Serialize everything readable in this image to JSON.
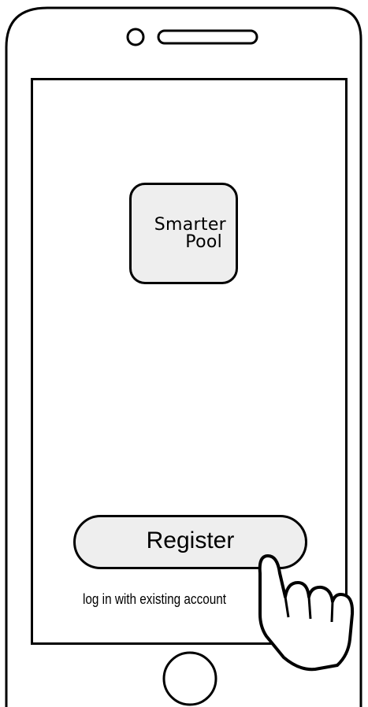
{
  "app": {
    "logo_line1": "Smarter",
    "logo_line2": "Pool"
  },
  "actions": {
    "register_label": "Register",
    "login_label": "log in with existing account"
  },
  "icons": {
    "pointer": "hand-pointer-icon",
    "camera": "camera-icon",
    "speaker": "speaker-icon",
    "home_button": "home-button-icon"
  },
  "colors": {
    "outline": "#000000",
    "fill": "#eeeeee",
    "background": "#ffffff"
  }
}
